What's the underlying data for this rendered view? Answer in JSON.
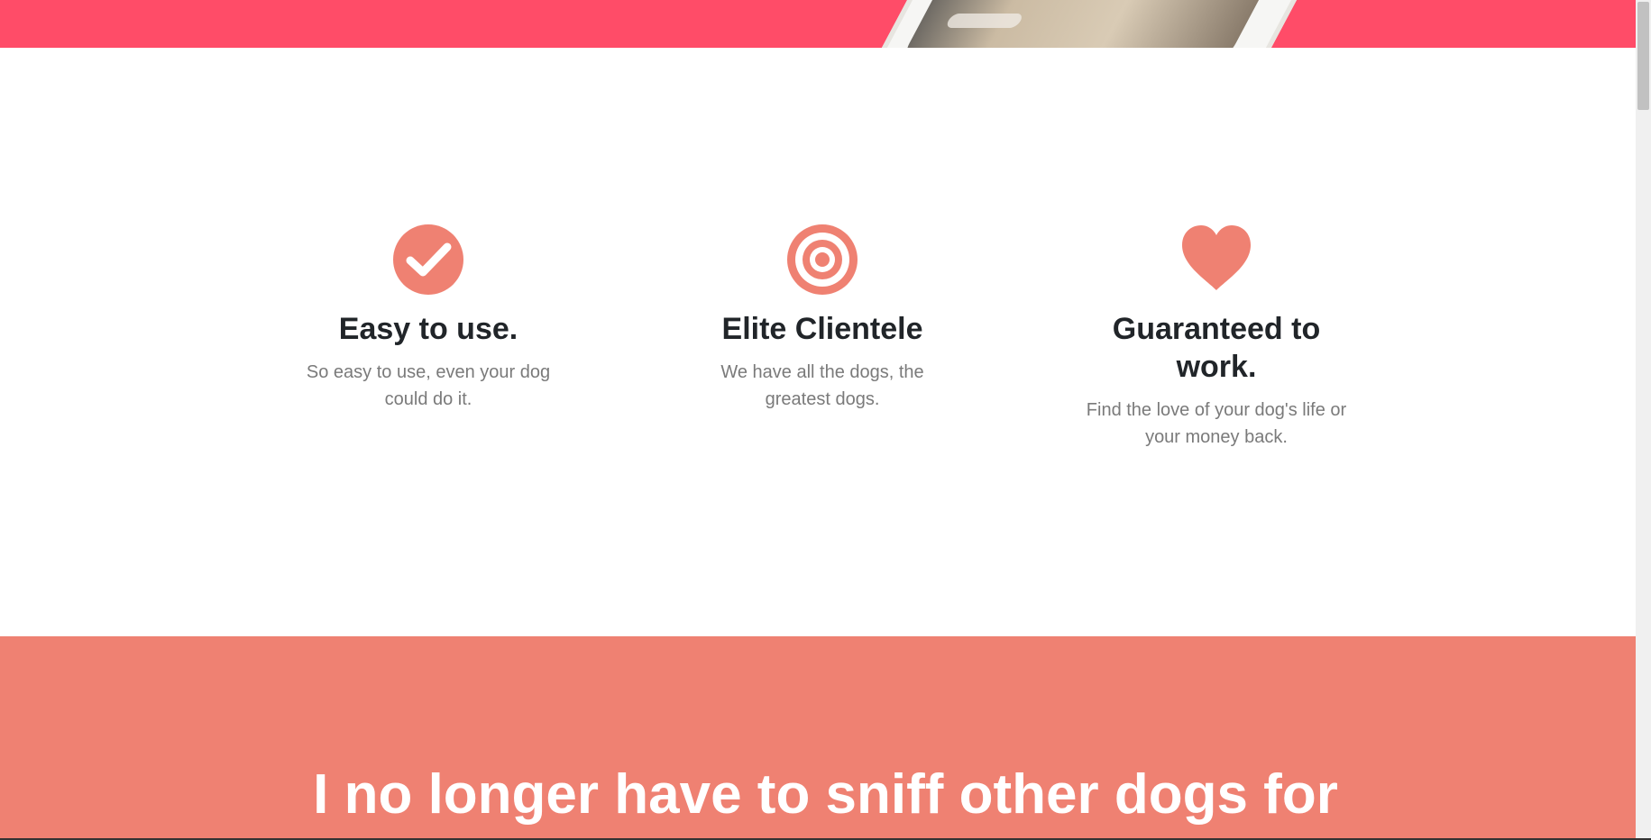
{
  "colors": {
    "header_bg": "#ff4c68",
    "accent": "#ef8172",
    "heading": "#212529",
    "body_text": "#7a7a7a"
  },
  "header": {
    "image": "phone-photo-image"
  },
  "features": [
    {
      "icon": "check-circle-icon",
      "title": "Easy to use.",
      "text": "So easy to use, even your dog could do it."
    },
    {
      "icon": "target-icon",
      "title": "Elite Clientele",
      "text": "We have all the dogs, the greatest dogs."
    },
    {
      "icon": "heart-icon",
      "title": "Guaranteed to work.",
      "text": "Find the love of your dog's life or your money back."
    }
  ],
  "testimonial": {
    "quote": "I no longer have to sniff other dogs for"
  }
}
